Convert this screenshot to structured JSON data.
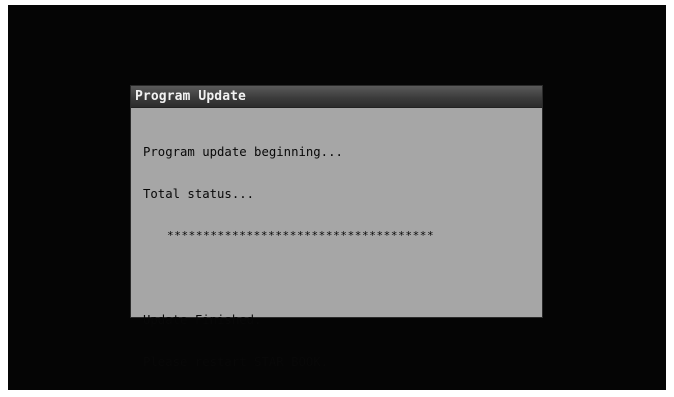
{
  "dialog": {
    "title": "Program Update",
    "lines": {
      "beginning": "Program update beginning...",
      "total_status": "Total status...",
      "progress": "*************************************",
      "finished": "Update Finished.",
      "restart": "Please restart STAR BOOK."
    }
  },
  "colors": {
    "screen_background": "#050505",
    "dialog_background": "#a6a6a6",
    "titlebar": "#3c3c3c",
    "title_text": "#f2f2f2",
    "body_text": "#080808"
  }
}
